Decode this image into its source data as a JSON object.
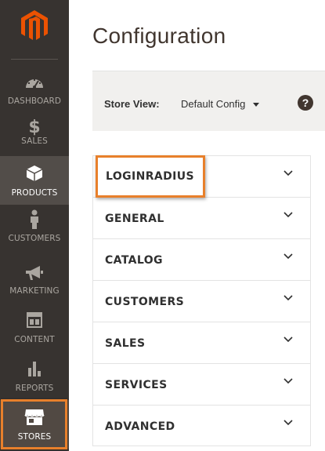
{
  "sidebar": {
    "logo": "magento-logo-icon",
    "items": [
      {
        "label": "DASHBOARD",
        "icon": "speedometer-icon"
      },
      {
        "label": "SALES",
        "icon": "dollar-icon"
      },
      {
        "label": "PRODUCTS",
        "icon": "cube-icon"
      },
      {
        "label": "CUSTOMERS",
        "icon": "person-icon"
      },
      {
        "label": "MARKETING",
        "icon": "megaphone-icon"
      },
      {
        "label": "CONTENT",
        "icon": "layout-icon"
      },
      {
        "label": "REPORTS",
        "icon": "bar-chart-icon"
      },
      {
        "label": "STORES",
        "icon": "storefront-icon"
      }
    ],
    "active": "PRODUCTS",
    "highlighted": "STORES"
  },
  "page": {
    "title": "Configuration"
  },
  "store_switcher": {
    "label": "Store View:",
    "value": "Default Config",
    "help": "?"
  },
  "sections": [
    {
      "title": "LOGINRADIUS",
      "highlighted": true
    },
    {
      "title": "GENERAL"
    },
    {
      "title": "CATALOG"
    },
    {
      "title": "CUSTOMERS"
    },
    {
      "title": "SALES"
    },
    {
      "title": "SERVICES"
    },
    {
      "title": "ADVANCED"
    }
  ],
  "colors": {
    "sidebar_bg": "#373330",
    "accent_orange": "#e8802b",
    "logo_orange": "#eb5202",
    "title_text": "#41362f"
  }
}
